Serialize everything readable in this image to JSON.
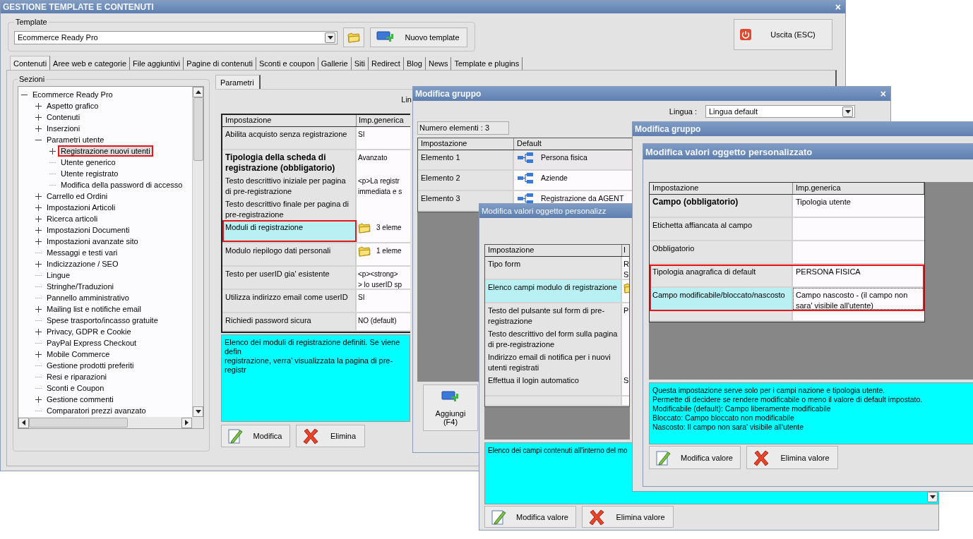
{
  "main_window": {
    "title": "GESTIONE TEMPLATE E CONTENUTI",
    "close": "×",
    "template_group": {
      "label": "Template",
      "value": "Ecommerce Ready Pro",
      "new_button": "Nuovo template"
    },
    "exit_button": "Uscita (ESC)",
    "tabs": [
      {
        "label": "Contenuti",
        "selected": true
      },
      {
        "label": "Aree web e categorie",
        "selected": false
      },
      {
        "label": "File aggiuntivi",
        "selected": false
      },
      {
        "label": "Pagine di contenuti",
        "selected": false
      },
      {
        "label": "Sconti e coupon",
        "selected": false
      },
      {
        "label": "Gallerie",
        "selected": false
      },
      {
        "label": "Siti",
        "selected": false
      },
      {
        "label": "Redirect",
        "selected": false
      },
      {
        "label": "Blog",
        "selected": false
      },
      {
        "label": "News",
        "selected": false
      },
      {
        "label": "Template e plugins",
        "selected": false
      }
    ],
    "sections": {
      "label": "Sezioni",
      "tree": [
        {
          "label": "Ecommerce Ready Pro",
          "expandable": true,
          "selected": false,
          "highlighted": false,
          "children": [
            {
              "label": "Aspetto grafico",
              "expandable": true,
              "selected": false,
              "highlighted": false
            },
            {
              "label": "Contenuti",
              "expandable": true,
              "selected": false,
              "highlighted": false
            },
            {
              "label": "Inserzioni",
              "expandable": true,
              "selected": false,
              "highlighted": false
            },
            {
              "label": "Parametri utente",
              "expandable": true,
              "selected": false,
              "highlighted": false,
              "children": [
                {
                  "label": "Registrazione nuovi utenti",
                  "expandable": true,
                  "selected": true,
                  "highlighted": true
                },
                {
                  "label": "Utente generico",
                  "expandable": false,
                  "selected": false,
                  "highlighted": false
                },
                {
                  "label": "Utente registrato",
                  "expandable": false,
                  "selected": false,
                  "highlighted": false
                },
                {
                  "label": "Modifica della password di accesso",
                  "expandable": false,
                  "selected": false,
                  "highlighted": false
                }
              ]
            },
            {
              "label": "Carrello ed Ordini",
              "expandable": true,
              "selected": false,
              "highlighted": false
            },
            {
              "label": "Impostazioni Articoli",
              "expandable": true,
              "selected": false,
              "highlighted": false
            },
            {
              "label": "Ricerca articoli",
              "expandable": true,
              "selected": false,
              "highlighted": false
            },
            {
              "label": "Impostazioni Documenti",
              "expandable": true,
              "selected": false,
              "highlighted": false
            },
            {
              "label": "Impostazioni avanzate sito",
              "expandable": true,
              "selected": false,
              "highlighted": false
            },
            {
              "label": "Messaggi e testi vari",
              "expandable": false,
              "selected": false,
              "highlighted": false
            },
            {
              "label": "Indicizzazione / SEO",
              "expandable": true,
              "selected": false,
              "highlighted": false
            },
            {
              "label": "Lingue",
              "expandable": false,
              "selected": false,
              "highlighted": false
            },
            {
              "label": "Stringhe/Traduzioni",
              "expandable": false,
              "selected": false,
              "highlighted": false
            },
            {
              "label": "Pannello amministrativo",
              "expandable": false,
              "selected": false,
              "highlighted": false
            },
            {
              "label": "Mailing list e notifiche email",
              "expandable": true,
              "selected": false,
              "highlighted": false
            },
            {
              "label": "Spese trasporto/incasso gratuite",
              "expandable": false,
              "selected": false,
              "highlighted": false
            },
            {
              "label": "Privacy, GDPR e Cookie",
              "expandable": true,
              "selected": false,
              "highlighted": false
            },
            {
              "label": "PayPal Express Checkout",
              "expandable": false,
              "selected": false,
              "highlighted": false
            },
            {
              "label": "Mobile Commerce",
              "expandable": true,
              "selected": false,
              "highlighted": false
            },
            {
              "label": "Gestione prodotti preferiti",
              "expandable": false,
              "selected": false,
              "highlighted": false
            },
            {
              "label": "Resi e riparazioni",
              "expandable": false,
              "selected": false,
              "highlighted": false
            },
            {
              "label": "Sconti e Coupon",
              "expandable": false,
              "selected": false,
              "highlighted": false
            },
            {
              "label": "Gestione commenti",
              "expandable": true,
              "selected": false,
              "highlighted": false
            },
            {
              "label": "Comparatori prezzi avanzato",
              "expandable": false,
              "selected": false,
              "highlighted": false
            }
          ]
        }
      ]
    },
    "subtab": "Parametri",
    "language_label": "Lin",
    "table": {
      "columns": [
        "Impostazione",
        "Imp.generica"
      ],
      "rows": [
        {
          "setting": "Abilita acquisto senza registrazione",
          "value": "SI",
          "bold": false,
          "selected": false,
          "highlighted": false,
          "icon": false
        },
        {
          "setting": "Tipologia della scheda di registrazione (obbligatorio)",
          "value": "Avanzato",
          "bold": true,
          "selected": false,
          "highlighted": false,
          "icon": false
        },
        {
          "setting": "Testo descrittivo iniziale per pagina di pre-registrazione",
          "value": "<p>La registr\nimmediata e s",
          "bold": false,
          "selected": false,
          "highlighted": false,
          "icon": false
        },
        {
          "setting": "Testo descrittivo finale per pagina di pre-registrazione",
          "value": "",
          "bold": false,
          "selected": false,
          "highlighted": false,
          "icon": false
        },
        {
          "setting": "Moduli di registrazione",
          "value": "3 eleme",
          "bold": false,
          "selected": true,
          "highlighted": true,
          "icon": true
        },
        {
          "setting": "Modulo riepilogo dati personali",
          "value": "1 eleme",
          "bold": false,
          "selected": false,
          "highlighted": false,
          "icon": true
        },
        {
          "setting": "Testo per userID gia' esistente",
          "value": "<p><strong>\n> lo userID sp",
          "bold": false,
          "selected": false,
          "highlighted": false,
          "icon": false
        },
        {
          "setting": "Utilizza indirizzo email come userID",
          "value": "SI",
          "bold": false,
          "selected": false,
          "highlighted": false,
          "icon": false
        },
        {
          "setting": "Richiedi password sicura",
          "value": "NO (default)",
          "bold": false,
          "selected": false,
          "highlighted": false,
          "icon": false
        }
      ]
    },
    "description": "Elenco dei moduli di registrazione definiti. Se viene defin\nregistrazione, verra' visualizzata la pagina di pre-registr",
    "buttons": [
      {
        "label": "Modifica",
        "kind": "edit"
      },
      {
        "label": "Elimina",
        "kind": "delete"
      }
    ]
  },
  "group_window": {
    "title": "Modifica gruppo",
    "close": "×",
    "language_label": "Lingua :",
    "language_value": "Lingua default",
    "count": "Numero elementi : 3",
    "table": {
      "columns": [
        "Impostazione",
        "Default"
      ],
      "rows": [
        {
          "setting": "Elemento 1",
          "value": "Persona fisica",
          "selected": true
        },
        {
          "setting": "Elemento 2",
          "value": "Aziende",
          "selected": false
        },
        {
          "setting": "Elemento 3",
          "value": "Registrazione da AGENT",
          "selected": false
        }
      ]
    },
    "add_button": "Aggiungi (F4)"
  },
  "object_window": {
    "title": "Modifica valori oggetto personalizz",
    "table": {
      "columns": [
        "Impostazione",
        "I"
      ],
      "rows": [
        {
          "setting": "Tipo form",
          "value": "R\nS",
          "selected": false,
          "icon": false
        },
        {
          "setting": "Elenco campi modulo di registrazione",
          "value": "",
          "selected": true,
          "icon": true
        },
        {
          "setting": "Testo del pulsante sul form di pre-registrazione",
          "value": "P",
          "selected": false,
          "icon": false
        },
        {
          "setting": "Testo descrittivo del form sulla pagina di pre-registrazione",
          "value": "",
          "selected": false,
          "icon": false
        },
        {
          "setting": "Indirizzo email di notifica per i nuovi utenti registrati",
          "value": "",
          "selected": false,
          "icon": false
        },
        {
          "setting": "Effettua il login automatico",
          "value": "S",
          "selected": false,
          "icon": false
        }
      ]
    },
    "description": "Elenco dei campi contenuti all'interno del mo",
    "buttons": [
      {
        "label": "Modifica valore",
        "kind": "edit"
      },
      {
        "label": "Elimina valore",
        "kind": "delete"
      }
    ]
  },
  "group_window_2": {
    "title": "Modifica gruppo"
  },
  "field_window": {
    "title": "Modifica valori oggetto personalizzato",
    "table": {
      "columns": [
        "Impostazione",
        "Imp.generica"
      ],
      "rows": [
        {
          "setting": "Campo (obbligatorio)",
          "value": "Tipologia utente",
          "bold": true,
          "selected": false,
          "highlighted": false
        },
        {
          "setting": "Etichetta affiancata al campo",
          "value": "",
          "bold": false,
          "selected": false,
          "highlighted": false
        },
        {
          "setting": "Obbligatorio",
          "value": "",
          "bold": false,
          "selected": false,
          "highlighted": false
        },
        {
          "setting": "Tipologia anagrafica di default",
          "value": "PERSONA FISICA",
          "bold": false,
          "selected": false,
          "highlighted": true
        },
        {
          "setting": "Campo modificabile/bloccato/nascosto",
          "value": "Campo nascosto - (il campo non sara' visibile all'utente)",
          "bold": false,
          "selected": true,
          "highlighted": true
        }
      ]
    },
    "description": "Questa impostazione serve solo per i campi nazione e tipologia utente.\nPermette di decidere se rendere modificabile o meno il valore di default impostato.\nModificabile (default): Campo liberamente modificabile\nBloccato: Campo bloccato non modificabile\nNascosto: Il campo non sara' visibile all'utente",
    "buttons": [
      {
        "label": "Modifica valore",
        "kind": "edit"
      },
      {
        "label": "Elimina valore",
        "kind": "delete"
      }
    ]
  }
}
